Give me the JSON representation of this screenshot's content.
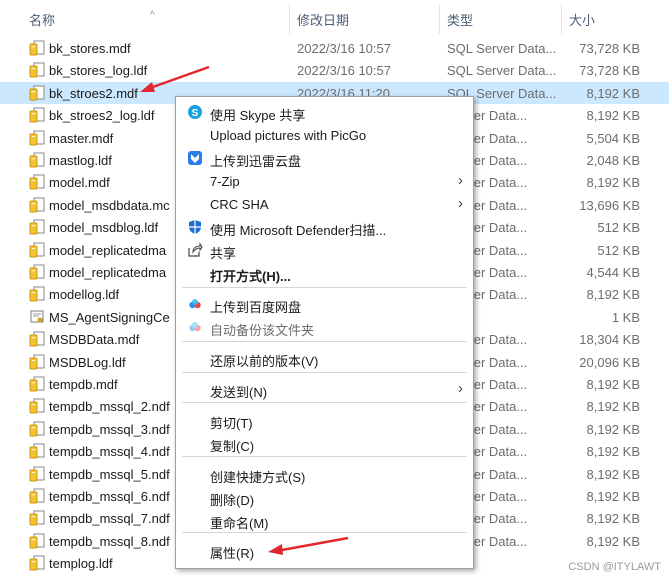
{
  "header": {
    "name": "名称",
    "date": "修改日期",
    "type": "类型",
    "size": "大小"
  },
  "files": [
    {
      "name": "bk_stores.mdf",
      "date": "2022/3/16 10:57",
      "type": "SQL Server Data...",
      "size": "73,728 KB",
      "icon": "mdf-file-icon"
    },
    {
      "name": "bk_stores_log.ldf",
      "date": "2022/3/16 10:57",
      "type": "SQL Server Data...",
      "size": "73,728 KB",
      "icon": "mdf-file-icon"
    },
    {
      "name": "bk_stroes2.mdf",
      "date": "2022/3/16 11:20",
      "type": "SQL Server Data...",
      "size": "8,192 KB",
      "icon": "mdf-file-icon",
      "selected": true
    },
    {
      "name": "bk_stroes2_log.ldf",
      "date": "",
      "type": "Server Data...",
      "size": "8,192 KB",
      "icon": "mdf-file-icon"
    },
    {
      "name": "master.mdf",
      "date": "",
      "type": "Server Data...",
      "size": "5,504 KB",
      "icon": "mdf-file-icon"
    },
    {
      "name": "mastlog.ldf",
      "date": "",
      "type": "Server Data...",
      "size": "2,048 KB",
      "icon": "mdf-file-icon"
    },
    {
      "name": "model.mdf",
      "date": "",
      "type": "Server Data...",
      "size": "8,192 KB",
      "icon": "mdf-file-icon"
    },
    {
      "name": "model_msdbdata.mc",
      "date": "",
      "type": "Server Data...",
      "size": "13,696 KB",
      "icon": "mdf-file-icon"
    },
    {
      "name": "model_msdblog.ldf",
      "date": "",
      "type": "Server Data...",
      "size": "512 KB",
      "icon": "mdf-file-icon"
    },
    {
      "name": "model_replicatedma",
      "date": "",
      "type": "Server Data...",
      "size": "512 KB",
      "icon": "mdf-file-icon"
    },
    {
      "name": "model_replicatedma",
      "date": "",
      "type": "Server Data...",
      "size": "4,544 KB",
      "icon": "mdf-file-icon"
    },
    {
      "name": "modellog.ldf",
      "date": "",
      "type": "Server Data...",
      "size": "8,192 KB",
      "icon": "mdf-file-icon"
    },
    {
      "name": "MS_AgentSigningCe",
      "date": "",
      "type": "证书",
      "size": "1 KB",
      "icon": "certificate-file-icon"
    },
    {
      "name": "MSDBData.mdf",
      "date": "",
      "type": "Server Data...",
      "size": "18,304 KB",
      "icon": "mdf-file-icon"
    },
    {
      "name": "MSDBLog.ldf",
      "date": "",
      "type": "Server Data...",
      "size": "20,096 KB",
      "icon": "mdf-file-icon"
    },
    {
      "name": "tempdb.mdf",
      "date": "",
      "type": "Server Data...",
      "size": "8,192 KB",
      "icon": "mdf-file-icon"
    },
    {
      "name": "tempdb_mssql_2.ndf",
      "date": "",
      "type": "Server Data...",
      "size": "8,192 KB",
      "icon": "mdf-file-icon"
    },
    {
      "name": "tempdb_mssql_3.ndf",
      "date": "",
      "type": "Server Data...",
      "size": "8,192 KB",
      "icon": "mdf-file-icon"
    },
    {
      "name": "tempdb_mssql_4.ndf",
      "date": "",
      "type": "Server Data...",
      "size": "8,192 KB",
      "icon": "mdf-file-icon"
    },
    {
      "name": "tempdb_mssql_5.ndf",
      "date": "",
      "type": "Server Data...",
      "size": "8,192 KB",
      "icon": "mdf-file-icon"
    },
    {
      "name": "tempdb_mssql_6.ndf",
      "date": "",
      "type": "Server Data...",
      "size": "8,192 KB",
      "icon": "mdf-file-icon"
    },
    {
      "name": "tempdb_mssql_7.ndf",
      "date": "",
      "type": "Server Data...",
      "size": "8,192 KB",
      "icon": "mdf-file-icon"
    },
    {
      "name": "tempdb_mssql_8.ndf",
      "date": "",
      "type": "Server Data...",
      "size": "8,192 KB",
      "icon": "mdf-file-icon"
    },
    {
      "name": "templog.ldf",
      "date": "",
      "type": "",
      "size": "",
      "icon": "mdf-file-icon"
    }
  ],
  "context_menu": {
    "items": [
      {
        "label": "使用 Skype 共享",
        "icon": "skype-icon",
        "name": "menu-item-skype-share"
      },
      {
        "label": "Upload pictures with PicGo",
        "icon": "picgo-icon",
        "name": "menu-item-picgo-upload"
      },
      {
        "label": "上传到迅雷云盘",
        "icon": "xunlei-icon",
        "name": "menu-item-xunlei-upload"
      },
      {
        "label": "7-Zip",
        "submenu": true,
        "name": "menu-item-7zip"
      },
      {
        "label": "CRC SHA",
        "submenu": true,
        "name": "menu-item-crc-sha"
      },
      {
        "label": "使用 Microsoft Defender扫描...",
        "icon": "defender-shield-icon",
        "name": "menu-item-defender-scan"
      },
      {
        "label": "共享",
        "icon": "share-icon",
        "name": "menu-item-share"
      },
      {
        "label": "打开方式(H)...",
        "bold": true,
        "name": "menu-item-open-with"
      },
      {
        "label": "上传到百度网盘",
        "icon": "baidu-cloud-icon",
        "name": "menu-item-baidu-upload"
      },
      {
        "label": "自动备份该文件夹",
        "icon": "baidu-backup-icon",
        "disabled": true,
        "name": "menu-item-auto-backup"
      },
      {
        "label": "还原以前的版本(V)",
        "name": "menu-item-restore-versions"
      },
      {
        "label": "发送到(N)",
        "submenu": true,
        "name": "menu-item-send-to"
      },
      {
        "label": "剪切(T)",
        "name": "menu-item-cut"
      },
      {
        "label": "复制(C)",
        "name": "menu-item-copy"
      },
      {
        "label": "创建快捷方式(S)",
        "name": "menu-item-create-shortcut"
      },
      {
        "label": "删除(D)",
        "name": "menu-item-delete"
      },
      {
        "label": "重命名(M)",
        "name": "menu-item-rename"
      },
      {
        "label": "属性(R)",
        "name": "menu-item-properties"
      }
    ]
  },
  "watermark": "CSDN @ITYLAWT",
  "colors": {
    "selected_row": "#cce8ff",
    "annotation_arrow": "#e0282e",
    "file_icon_yellow": "#f2c230"
  }
}
